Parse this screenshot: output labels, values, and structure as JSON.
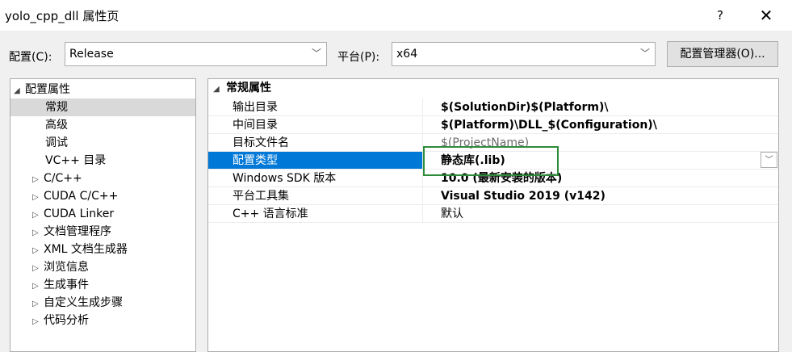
{
  "window": {
    "title": "yolo_cpp_dll 属性页",
    "help": "?",
    "close": "✕"
  },
  "toolbar": {
    "config_label": "配置(C):",
    "config_value": "Release",
    "platform_label": "平台(P):",
    "platform_value": "x64",
    "manager_button": "配置管理器(O)..."
  },
  "tree": {
    "root": {
      "label": "配置属性",
      "toggle": "◢"
    },
    "items": [
      {
        "label": "常规",
        "toggle": ""
      },
      {
        "label": "高级",
        "toggle": ""
      },
      {
        "label": "调试",
        "toggle": ""
      },
      {
        "label": "VC++ 目录",
        "toggle": ""
      },
      {
        "label": "C/C++",
        "toggle": "▷"
      },
      {
        "label": "CUDA C/C++",
        "toggle": "▷"
      },
      {
        "label": "CUDA Linker",
        "toggle": "▷"
      },
      {
        "label": "文档管理程序",
        "toggle": "▷"
      },
      {
        "label": "XML 文档生成器",
        "toggle": "▷"
      },
      {
        "label": "浏览信息",
        "toggle": "▷"
      },
      {
        "label": "生成事件",
        "toggle": "▷"
      },
      {
        "label": "自定义生成步骤",
        "toggle": "▷"
      },
      {
        "label": "代码分析",
        "toggle": "▷"
      }
    ]
  },
  "grid": {
    "section": {
      "label": "常规属性",
      "toggle": "◢"
    },
    "rows": [
      {
        "name": "输出目录",
        "value": "$(SolutionDir)$(Platform)\\"
      },
      {
        "name": "中间目录",
        "value": "$(Platform)\\DLL_$(Configuration)\\"
      },
      {
        "name": "目标文件名",
        "value": "$(ProjectName)"
      },
      {
        "name": "配置类型",
        "value": "静态库(.lib)"
      },
      {
        "name": "Windows SDK 版本",
        "value": "10.0 (最新安装的版本)"
      },
      {
        "name": "平台工具集",
        "value": "Visual Studio 2019 (v142)"
      },
      {
        "name": "C++ 语言标准",
        "value": "默认"
      }
    ]
  },
  "icons": {
    "dropdown": "chevron-down-icon"
  },
  "colors": {
    "selection": "#0078d7",
    "highlight_box": "#2e8b3a"
  }
}
